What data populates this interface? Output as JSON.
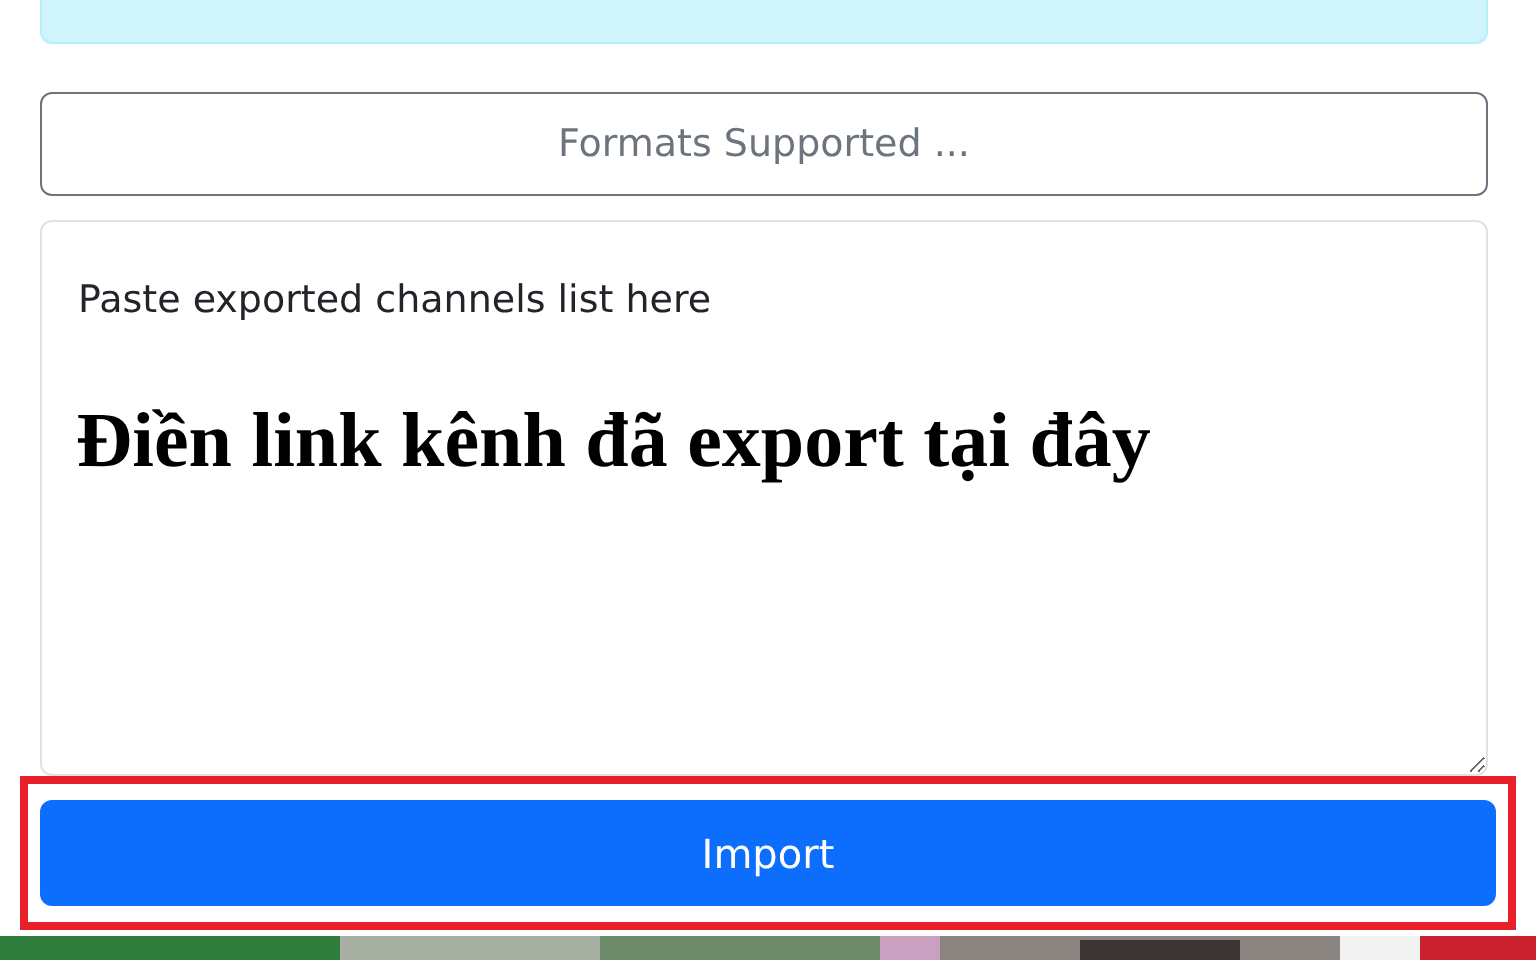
{
  "formats_button": {
    "label": "Formats Supported ..."
  },
  "channels_field": {
    "placeholder": "Paste exported channels list here"
  },
  "annotation": {
    "text": "Điền link kênh đã export tại đây"
  },
  "import_button": {
    "label": "Import",
    "highlighted": true
  }
}
